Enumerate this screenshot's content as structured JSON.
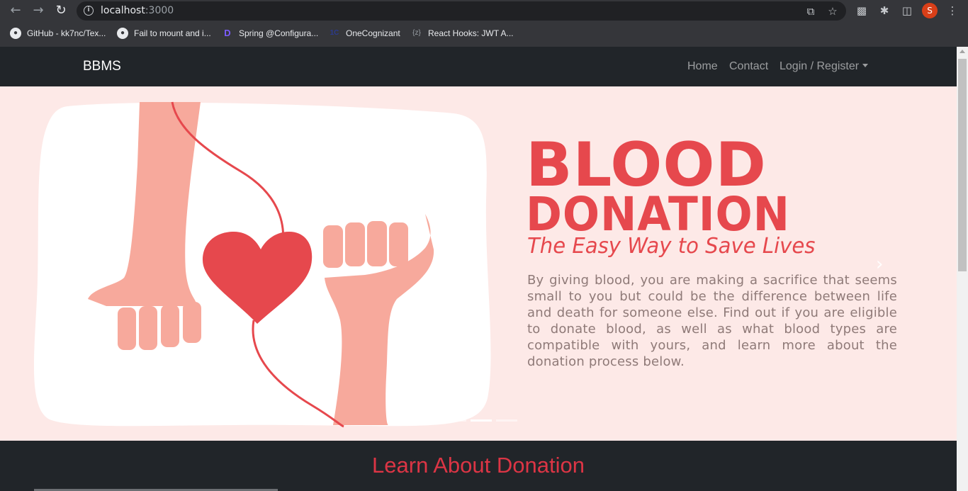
{
  "browser": {
    "url_host": "localhost",
    "url_port": ":3000",
    "profile_initial": "S",
    "bookmarks": [
      {
        "label": "GitHub - kk7nc/Tex...",
        "icon": "github-icon"
      },
      {
        "label": "Fail to mount and i...",
        "icon": "github-icon"
      },
      {
        "label": "Spring @Configura...",
        "icon": "spring-icon"
      },
      {
        "label": "OneCognizant",
        "icon": "onecognizant-icon"
      },
      {
        "label": "React Hooks: JWT A...",
        "icon": "bracket-z-icon"
      }
    ]
  },
  "navbar": {
    "brand": "BBMS",
    "links": [
      "Home",
      "Contact",
      "Login / Register"
    ]
  },
  "hero": {
    "title_line1": "BLOOD",
    "title_line2": "DONATION",
    "subtitle": "The Easy Way to Save Lives",
    "body": "By giving blood, you are making a sacrifice that seems small to you but could be the difference between life and death for someone else. Find out if you are eligible to donate blood, as well as what blood types are compatible with yours, and learn more about the donation process below.",
    "next_glyph": "›",
    "indicator_count": 3,
    "active_indicator": 1
  },
  "section": {
    "title": "Learn About Donation"
  },
  "colors": {
    "accent": "#dc3545",
    "hero_bg": "#fde9e7",
    "hero_red": "#e6484d",
    "skin": "#f7a99c"
  }
}
